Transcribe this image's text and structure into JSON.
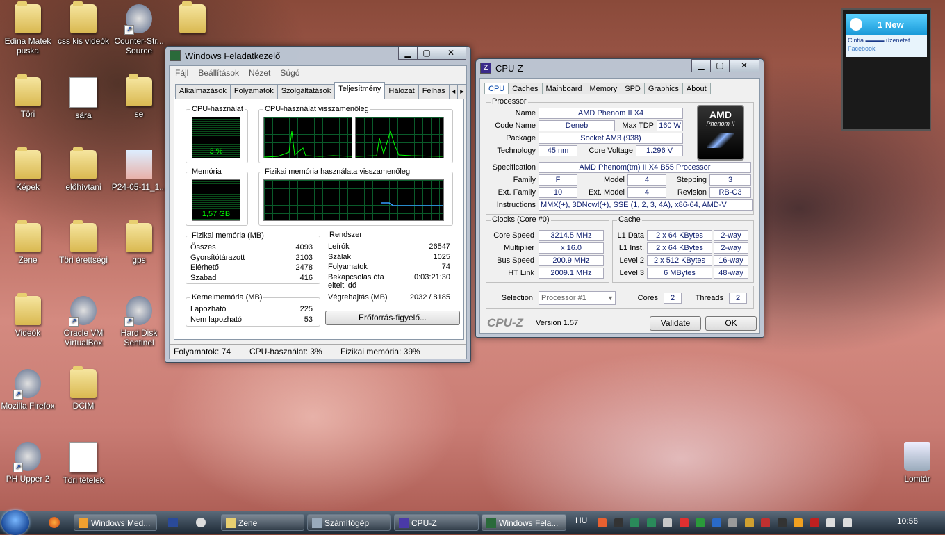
{
  "desktop_icons": [
    {
      "label": "Edina Matek\npuska",
      "type": "folder"
    },
    {
      "label": "css kis videók",
      "type": "folder"
    },
    {
      "label": "Counter-Str...\nSource",
      "type": "app"
    },
    {
      "label": "",
      "type": "folder"
    },
    {
      "label": "Töri",
      "type": "folder"
    },
    {
      "label": "sára",
      "type": "doc"
    },
    {
      "label": "se",
      "type": "folder"
    },
    {
      "label": "Képek",
      "type": "folder"
    },
    {
      "label": "előhívtani",
      "type": "folder"
    },
    {
      "label": "P24-05-11_1...",
      "type": "image"
    },
    {
      "label": "Zene",
      "type": "folder"
    },
    {
      "label": "Töri érettségi",
      "type": "folder"
    },
    {
      "label": "gps",
      "type": "folder"
    },
    {
      "label": "Videók",
      "type": "folder"
    },
    {
      "label": "Oracle VM\nVirtualBox",
      "type": "app"
    },
    {
      "label": "Hard Disk\nSentinel",
      "type": "app"
    },
    {
      "label": "Mozilla Firefox",
      "type": "app"
    },
    {
      "label": "DCIM",
      "type": "folder"
    },
    {
      "label": "PH Upper 2",
      "type": "app"
    },
    {
      "label": "Töri tételek",
      "type": "doc"
    },
    {
      "label": "Lomtár",
      "type": "recycle"
    }
  ],
  "taskmgr": {
    "title": "Windows Feladatkezelő",
    "menu": [
      "Fájl",
      "Beállítások",
      "Nézet",
      "Súgó"
    ],
    "tabs": [
      "Alkalmazások",
      "Folyamatok",
      "Szolgáltatások",
      "Teljesítmény",
      "Hálózat",
      "Felhas"
    ],
    "cpu_usage_title": "CPU-használat",
    "cpu_usage_value": "3 %",
    "cpu_history_title": "CPU-használat visszamenőleg",
    "memory_title": "Memória",
    "memory_value": "1,57 GB",
    "memory_history_title": "Fizikai memória használata visszamenőleg",
    "physmem": {
      "title": "Fizikai memória (MB)",
      "rows": [
        [
          "Összes",
          "4093"
        ],
        [
          "Gyorsítótárazott",
          "2103"
        ],
        [
          "Elérhető",
          "2478"
        ],
        [
          "Szabad",
          "416"
        ]
      ]
    },
    "system": {
      "title": "Rendszer",
      "rows": [
        [
          "Leírók",
          "26547"
        ],
        [
          "Szálak",
          "1025"
        ],
        [
          "Folyamatok",
          "74"
        ],
        [
          "Bekapcsolás óta\neltelt idő",
          "0:03:21:30"
        ],
        [
          "Végrehajtás (MB)",
          "2032 / 8185"
        ]
      ]
    },
    "kernel": {
      "title": "Kernelmemória (MB)",
      "rows": [
        [
          "Lapozható",
          "225"
        ],
        [
          "Nem lapozható",
          "53"
        ]
      ]
    },
    "resmon_button": "Erőforrás-figyelő...",
    "status": [
      "Folyamatok: 74",
      "CPU-használat: 3%",
      "Fizikai memória: 39%"
    ]
  },
  "cpuz": {
    "title": "CPU-Z",
    "tabs": [
      "CPU",
      "Caches",
      "Mainboard",
      "Memory",
      "SPD",
      "Graphics",
      "About"
    ],
    "processor_title": "Processor",
    "name_label": "Name",
    "name": "AMD Phenom II X4",
    "codename_label": "Code Name",
    "codename": "Deneb",
    "maxtdp_label": "Max TDP",
    "maxtdp": "160 W",
    "package_label": "Package",
    "package": "Socket AM3 (938)",
    "technology_label": "Technology",
    "technology": "45 nm",
    "corevoltage_label": "Core Voltage",
    "corevoltage": "1.296 V",
    "spec_label": "Specification",
    "spec": "AMD Phenom(tm) II X4 B55 Processor",
    "family_label": "Family",
    "family": "F",
    "model_label": "Model",
    "model": "4",
    "stepping_label": "Stepping",
    "stepping": "3",
    "extfamily_label": "Ext. Family",
    "extfamily": "10",
    "extmodel_label": "Ext. Model",
    "extmodel": "4",
    "revision_label": "Revision",
    "revision": "RB-C3",
    "instructions_label": "Instructions",
    "instructions": "MMX(+), 3DNow!(+), SSE (1, 2, 3, 4A), x86-64, AMD-V",
    "logo_brand": "AMD",
    "logo_model": "Phenom II",
    "clocks_title": "Clocks (Core #0)",
    "corespeed_label": "Core Speed",
    "corespeed": "3214.5 MHz",
    "multiplier_label": "Multiplier",
    "multiplier": "x 16.0",
    "busspeed_label": "Bus Speed",
    "busspeed": "200.9 MHz",
    "htlink_label": "HT Link",
    "htlink": "2009.1 MHz",
    "cache_title": "Cache",
    "cache": [
      [
        "L1 Data",
        "2 x 64 KBytes",
        "2-way"
      ],
      [
        "L1 Inst.",
        "2 x 64 KBytes",
        "2-way"
      ],
      [
        "Level 2",
        "2 x 512 KBytes",
        "16-way"
      ],
      [
        "Level 3",
        "6 MBytes",
        "48-way"
      ]
    ],
    "selection_label": "Selection",
    "selection": "Processor #1",
    "cores_label": "Cores",
    "cores": "2",
    "threads_label": "Threads",
    "threads": "2",
    "brand": "CPU-Z",
    "version": "Version 1.57",
    "validate_button": "Validate",
    "ok_button": "OK"
  },
  "notification": {
    "header": "1 New",
    "message": "Cintia ▬▬▬ üzenetet...",
    "source": "Facebook"
  },
  "taskbar": {
    "buttons": [
      "Windows Med...",
      "",
      "Zene",
      "Számítógép",
      "CPU-Z",
      "Windows Fela..."
    ],
    "language": "HU",
    "clock": "10:56"
  },
  "colors": {
    "accent": "#0044aa",
    "meter_green": "#00ff00",
    "taskbar": "#1e2a36"
  }
}
